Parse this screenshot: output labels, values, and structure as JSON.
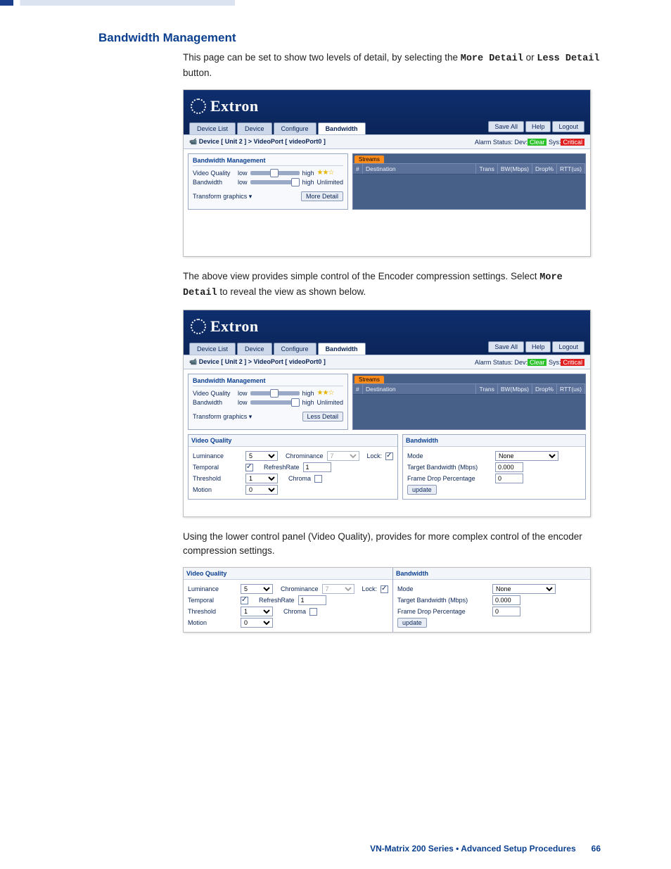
{
  "heading": "Bandwidth Management",
  "para1_a": "This page can be set to show two levels of detail, by selecting the ",
  "para1_b": "More Detail",
  "para1_c": " or ",
  "para1_d": "Less Detail",
  "para1_e": " button.",
  "para2_a": "The above view provides simple control of the Encoder compression settings. Select ",
  "para2_b": "More Detail",
  "para2_c": " to reveal the view as shown below.",
  "para3": "Using the lower control panel (Video Quality), provides for more complex control of the encoder compression settings.",
  "brand": "Extron",
  "tabs": {
    "device_list": "Device List",
    "device": "Device",
    "configure": "Configure",
    "bandwidth": "Bandwidth"
  },
  "top_buttons": {
    "save_all": "Save All",
    "help": "Help",
    "logout": "Logout"
  },
  "breadcrumb": "Device [ Unit 2 ]  >  VideoPort [ videoPort0 ]",
  "alarm_prefix": "Alarm Status: Dev:",
  "alarm_clear": "Clear",
  "alarm_mid": " Sys:",
  "alarm_crit": "Critical",
  "bw_panel_title": "Bandwidth Management",
  "labels": {
    "video_quality": "Video Quality",
    "bandwidth": "Bandwidth",
    "transform": "Transform",
    "low": "low",
    "high": "high",
    "unlimited": "Unlimited"
  },
  "transform_value": "graphics",
  "more_detail_btn": "More Detail",
  "less_detail_btn": "Less Detail",
  "streams_tab": "Streams",
  "streams_cols": {
    "num": "#",
    "dest": "Destination",
    "trans": "Trans",
    "bw": "BW(Mbps)",
    "drop": "Drop%",
    "rtt": "RTT(us)"
  },
  "vq_title": "Video Quality",
  "vq": {
    "luminance": "Luminance",
    "luminance_val": "5",
    "chrominance": "Chrominance",
    "chrominance_val": "7",
    "lock": "Lock:",
    "temporal": "Temporal",
    "refreshrate": "RefreshRate",
    "refreshrate_val": "1",
    "threshold": "Threshold",
    "threshold_val": "1",
    "chroma": "Chroma",
    "motion": "Motion",
    "motion_val": "0"
  },
  "bw_title": "Bandwidth",
  "bw": {
    "mode": "Mode",
    "mode_val": "None",
    "target": "Target Bandwidth (Mbps)",
    "target_val": "0.000",
    "drop": "Frame Drop Percentage",
    "drop_val": "0",
    "update": "update"
  },
  "footer_text": "VN-Matrix 200 Series  •  Advanced Setup Procedures",
  "footer_page": "66"
}
